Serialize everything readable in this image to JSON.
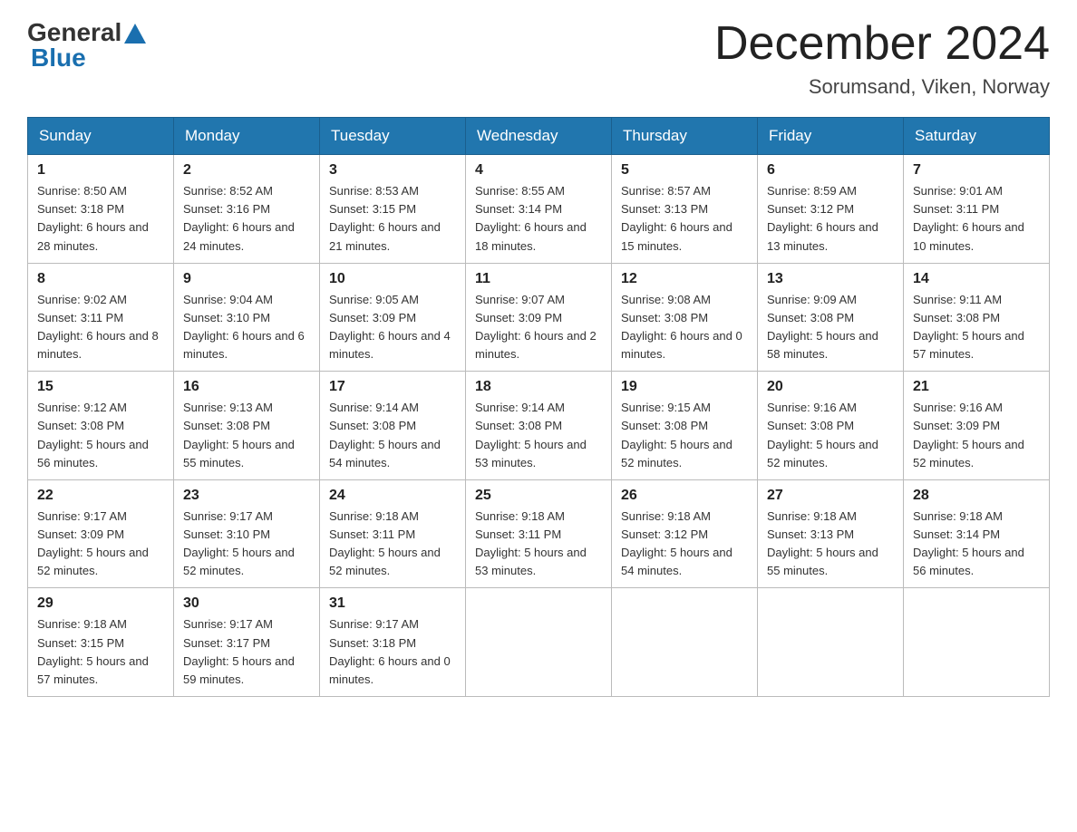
{
  "logo": {
    "general": "General",
    "blue": "Blue"
  },
  "title": "December 2024",
  "subtitle": "Sorumsand, Viken, Norway",
  "days_of_week": [
    "Sunday",
    "Monday",
    "Tuesday",
    "Wednesday",
    "Thursday",
    "Friday",
    "Saturday"
  ],
  "weeks": [
    [
      {
        "day": "1",
        "sunrise": "8:50 AM",
        "sunset": "3:18 PM",
        "daylight": "6 hours and 28 minutes."
      },
      {
        "day": "2",
        "sunrise": "8:52 AM",
        "sunset": "3:16 PM",
        "daylight": "6 hours and 24 minutes."
      },
      {
        "day": "3",
        "sunrise": "8:53 AM",
        "sunset": "3:15 PM",
        "daylight": "6 hours and 21 minutes."
      },
      {
        "day": "4",
        "sunrise": "8:55 AM",
        "sunset": "3:14 PM",
        "daylight": "6 hours and 18 minutes."
      },
      {
        "day": "5",
        "sunrise": "8:57 AM",
        "sunset": "3:13 PM",
        "daylight": "6 hours and 15 minutes."
      },
      {
        "day": "6",
        "sunrise": "8:59 AM",
        "sunset": "3:12 PM",
        "daylight": "6 hours and 13 minutes."
      },
      {
        "day": "7",
        "sunrise": "9:01 AM",
        "sunset": "3:11 PM",
        "daylight": "6 hours and 10 minutes."
      }
    ],
    [
      {
        "day": "8",
        "sunrise": "9:02 AM",
        "sunset": "3:11 PM",
        "daylight": "6 hours and 8 minutes."
      },
      {
        "day": "9",
        "sunrise": "9:04 AM",
        "sunset": "3:10 PM",
        "daylight": "6 hours and 6 minutes."
      },
      {
        "day": "10",
        "sunrise": "9:05 AM",
        "sunset": "3:09 PM",
        "daylight": "6 hours and 4 minutes."
      },
      {
        "day": "11",
        "sunrise": "9:07 AM",
        "sunset": "3:09 PM",
        "daylight": "6 hours and 2 minutes."
      },
      {
        "day": "12",
        "sunrise": "9:08 AM",
        "sunset": "3:08 PM",
        "daylight": "6 hours and 0 minutes."
      },
      {
        "day": "13",
        "sunrise": "9:09 AM",
        "sunset": "3:08 PM",
        "daylight": "5 hours and 58 minutes."
      },
      {
        "day": "14",
        "sunrise": "9:11 AM",
        "sunset": "3:08 PM",
        "daylight": "5 hours and 57 minutes."
      }
    ],
    [
      {
        "day": "15",
        "sunrise": "9:12 AM",
        "sunset": "3:08 PM",
        "daylight": "5 hours and 56 minutes."
      },
      {
        "day": "16",
        "sunrise": "9:13 AM",
        "sunset": "3:08 PM",
        "daylight": "5 hours and 55 minutes."
      },
      {
        "day": "17",
        "sunrise": "9:14 AM",
        "sunset": "3:08 PM",
        "daylight": "5 hours and 54 minutes."
      },
      {
        "day": "18",
        "sunrise": "9:14 AM",
        "sunset": "3:08 PM",
        "daylight": "5 hours and 53 minutes."
      },
      {
        "day": "19",
        "sunrise": "9:15 AM",
        "sunset": "3:08 PM",
        "daylight": "5 hours and 52 minutes."
      },
      {
        "day": "20",
        "sunrise": "9:16 AM",
        "sunset": "3:08 PM",
        "daylight": "5 hours and 52 minutes."
      },
      {
        "day": "21",
        "sunrise": "9:16 AM",
        "sunset": "3:09 PM",
        "daylight": "5 hours and 52 minutes."
      }
    ],
    [
      {
        "day": "22",
        "sunrise": "9:17 AM",
        "sunset": "3:09 PM",
        "daylight": "5 hours and 52 minutes."
      },
      {
        "day": "23",
        "sunrise": "9:17 AM",
        "sunset": "3:10 PM",
        "daylight": "5 hours and 52 minutes."
      },
      {
        "day": "24",
        "sunrise": "9:18 AM",
        "sunset": "3:11 PM",
        "daylight": "5 hours and 52 minutes."
      },
      {
        "day": "25",
        "sunrise": "9:18 AM",
        "sunset": "3:11 PM",
        "daylight": "5 hours and 53 minutes."
      },
      {
        "day": "26",
        "sunrise": "9:18 AM",
        "sunset": "3:12 PM",
        "daylight": "5 hours and 54 minutes."
      },
      {
        "day": "27",
        "sunrise": "9:18 AM",
        "sunset": "3:13 PM",
        "daylight": "5 hours and 55 minutes."
      },
      {
        "day": "28",
        "sunrise": "9:18 AM",
        "sunset": "3:14 PM",
        "daylight": "5 hours and 56 minutes."
      }
    ],
    [
      {
        "day": "29",
        "sunrise": "9:18 AM",
        "sunset": "3:15 PM",
        "daylight": "5 hours and 57 minutes."
      },
      {
        "day": "30",
        "sunrise": "9:17 AM",
        "sunset": "3:17 PM",
        "daylight": "5 hours and 59 minutes."
      },
      {
        "day": "31",
        "sunrise": "9:17 AM",
        "sunset": "3:18 PM",
        "daylight": "6 hours and 0 minutes."
      },
      null,
      null,
      null,
      null
    ]
  ],
  "labels": {
    "sunrise": "Sunrise:",
    "sunset": "Sunset:",
    "daylight": "Daylight:"
  }
}
